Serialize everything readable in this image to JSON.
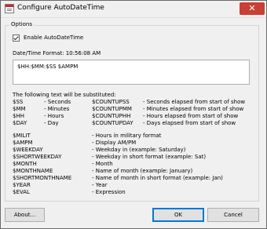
{
  "window": {
    "title": "Configure AutoDateTime",
    "close_glyph": "✕"
  },
  "group": {
    "label": "Options"
  },
  "enable": {
    "label": "Enable AutoDateTime",
    "checked": true
  },
  "format": {
    "label": "Date/Time Format: 10:56:08 AM",
    "value": "$HH:$MM:$SS $AMPM"
  },
  "substitutions": {
    "label": "The following text will be substituted:",
    "left": [
      {
        "token": "$SS",
        "desc": "- Seconds"
      },
      {
        "token": "$MM",
        "desc": "- Minutes"
      },
      {
        "token": "$HH",
        "desc": "- Hours"
      },
      {
        "token": "$DAY",
        "desc": "- Day"
      }
    ],
    "countup": [
      {
        "token": "$COUNTUPSS",
        "desc": "- Seconds elapsed from start of show"
      },
      {
        "token": "$COUNTUPMM",
        "desc": "- Minutes elapsed from start of show"
      },
      {
        "token": "$COUNTUPHH",
        "desc": "- Hours elapsed from start of show"
      },
      {
        "token": "$COUNTUPDAY",
        "desc": "- Days elapsed from start of show"
      }
    ],
    "more": [
      {
        "token": "$MILIT",
        "desc": "- Hours in military format"
      },
      {
        "token": "$AMPM",
        "desc": "- Display AM/PM"
      },
      {
        "token": "$WEEKDAY",
        "desc": "- Weekday in (example: Saturday)"
      },
      {
        "token": "$SHORTWEEKDAY",
        "desc": "- Weekday in short format (example: Sat)"
      },
      {
        "token": "$MONTH",
        "desc": "- Month"
      },
      {
        "token": "$MONTHNAME",
        "desc": "- Name of month (example: January)"
      },
      {
        "token": "$SHORTMONTHNAME",
        "desc": "- Name of month in short format (example: Jan)"
      },
      {
        "token": "$YEAR",
        "desc": "- Year"
      },
      {
        "token": "$EVAL",
        "desc": "- Expression"
      }
    ]
  },
  "buttons": {
    "about": "About...",
    "ok": "OK",
    "cancel": "Cancel"
  }
}
